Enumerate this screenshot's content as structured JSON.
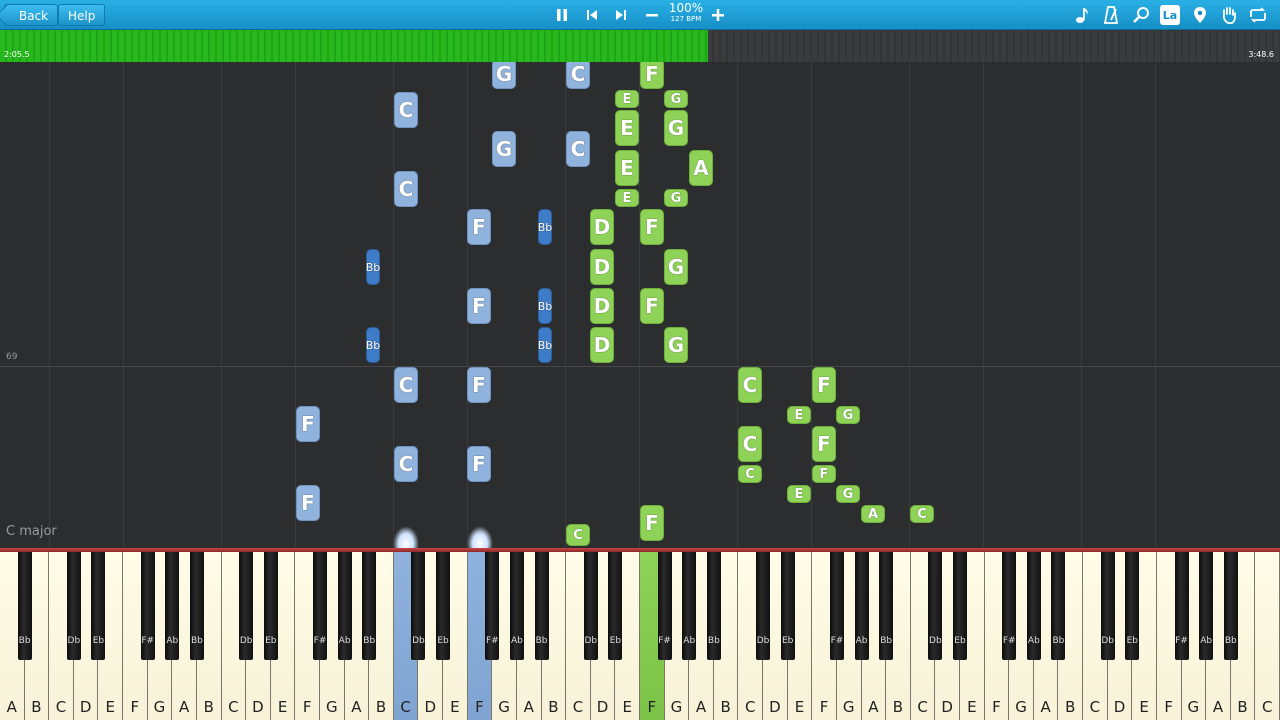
{
  "toolbar": {
    "back_label": "Back",
    "help_label": "Help",
    "zoom_label": "100%",
    "bpm_label": "127 BPM",
    "icons_left": [
      "pause-icon",
      "skip-back-icon",
      "skip-forward-icon",
      "minus-icon",
      "plus-icon"
    ],
    "icons_right": [
      "note-icon",
      "metronome-icon",
      "magnifier-icon",
      "la-icon",
      "location-pin-icon",
      "hand-icon",
      "loop-icon"
    ],
    "la_text": "La"
  },
  "progress": {
    "current_time": "2:05.5",
    "total_time": "3:48.6",
    "fraction": 0.553
  },
  "roll": {
    "measure_number": "69",
    "key_signature": "C major"
  },
  "notes": [
    {
      "label": "G",
      "color": "blue"
    },
    {
      "label": "C",
      "color": "blue"
    },
    {
      "label": "F",
      "color": "green"
    },
    {
      "label": "E",
      "color": "green"
    },
    {
      "label": "G",
      "color": "green"
    },
    {
      "label": "C",
      "color": "blue"
    },
    {
      "label": "E",
      "color": "green"
    },
    {
      "label": "G",
      "color": "green"
    },
    {
      "label": "G",
      "color": "blue"
    },
    {
      "label": "C",
      "color": "blue"
    },
    {
      "label": "E",
      "color": "green"
    },
    {
      "label": "A",
      "color": "green"
    },
    {
      "label": "C",
      "color": "blue"
    },
    {
      "label": "E",
      "color": "green"
    },
    {
      "label": "G",
      "color": "green"
    },
    {
      "label": "F",
      "color": "blue"
    },
    {
      "label": "Bb",
      "color": "dblue"
    },
    {
      "label": "D",
      "color": "green"
    },
    {
      "label": "F",
      "color": "green"
    },
    {
      "label": "Bb",
      "color": "dblue"
    },
    {
      "label": "D",
      "color": "green"
    },
    {
      "label": "G",
      "color": "green"
    },
    {
      "label": "F",
      "color": "blue"
    },
    {
      "label": "Bb",
      "color": "dblue"
    },
    {
      "label": "D",
      "color": "green"
    },
    {
      "label": "F",
      "color": "green"
    },
    {
      "label": "Bb",
      "color": "dblue"
    },
    {
      "label": "Bb",
      "color": "dblue"
    },
    {
      "label": "D",
      "color": "green"
    },
    {
      "label": "G",
      "color": "green"
    },
    {
      "label": "C",
      "color": "blue"
    },
    {
      "label": "F",
      "color": "blue"
    },
    {
      "label": "C",
      "color": "green"
    },
    {
      "label": "F",
      "color": "green"
    },
    {
      "label": "F",
      "color": "blue"
    },
    {
      "label": "E",
      "color": "green"
    },
    {
      "label": "G",
      "color": "green"
    },
    {
      "label": "C",
      "color": "blue"
    },
    {
      "label": "F",
      "color": "blue"
    },
    {
      "label": "C",
      "color": "green"
    },
    {
      "label": "F",
      "color": "green"
    },
    {
      "label": "C",
      "color": "green"
    },
    {
      "label": "F",
      "color": "green"
    },
    {
      "label": "F",
      "color": "blue"
    },
    {
      "label": "E",
      "color": "green"
    },
    {
      "label": "G",
      "color": "green"
    },
    {
      "label": "A",
      "color": "green"
    },
    {
      "label": "C",
      "color": "green"
    },
    {
      "label": "C",
      "color": "green"
    },
    {
      "label": "F",
      "color": "green"
    }
  ],
  "keyboard": {
    "white_keys": [
      "A",
      "B",
      "C",
      "D",
      "E",
      "F",
      "G",
      "A",
      "B",
      "C",
      "D",
      "E",
      "F",
      "G",
      "A",
      "B",
      "C",
      "D",
      "E",
      "F",
      "G",
      "A",
      "B",
      "C",
      "D",
      "E",
      "F",
      "G",
      "A",
      "B",
      "C",
      "D",
      "E",
      "F",
      "G",
      "A",
      "B",
      "C",
      "D",
      "E",
      "F",
      "G",
      "A",
      "B",
      "C",
      "D",
      "E",
      "F",
      "G",
      "A",
      "B",
      "C"
    ],
    "black_keys": [
      "Bb",
      "Db",
      "Eb",
      "F#",
      "Ab",
      "Bb",
      "Db",
      "Eb",
      "F#",
      "Ab",
      "Bb",
      "Db",
      "Eb",
      "F#",
      "Ab",
      "Bb",
      "Db",
      "Eb",
      "F#",
      "Ab",
      "Bb",
      "Db",
      "Eb",
      "F#",
      "Ab",
      "Bb",
      "Db",
      "Eb",
      "F#",
      "Ab",
      "Bb",
      "Db",
      "Eb",
      "F#",
      "Ab",
      "Bb"
    ],
    "pressed_white": {
      "16": "blue",
      "19": "blue",
      "26": "green"
    },
    "pressed_black": {},
    "colors": {
      "left_hand": "#8fb3dc",
      "right_hand": "#8ed357",
      "left_hand_dark": "#3e7cc7"
    }
  }
}
